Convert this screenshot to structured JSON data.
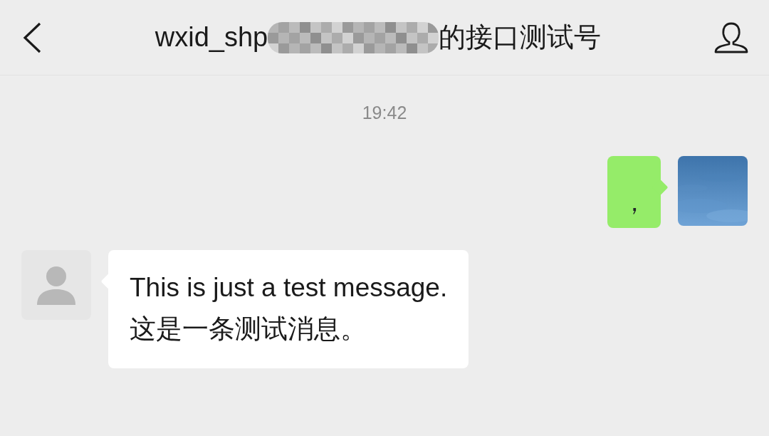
{
  "header": {
    "title_start": "wxid_shp",
    "title_end": "的接口测试号"
  },
  "timestamp": "19:42",
  "messages": [
    {
      "kind": "outgoing",
      "text": "，"
    },
    {
      "kind": "incoming",
      "text": "This is just a test message.\n这是一条测试消息。"
    }
  ]
}
